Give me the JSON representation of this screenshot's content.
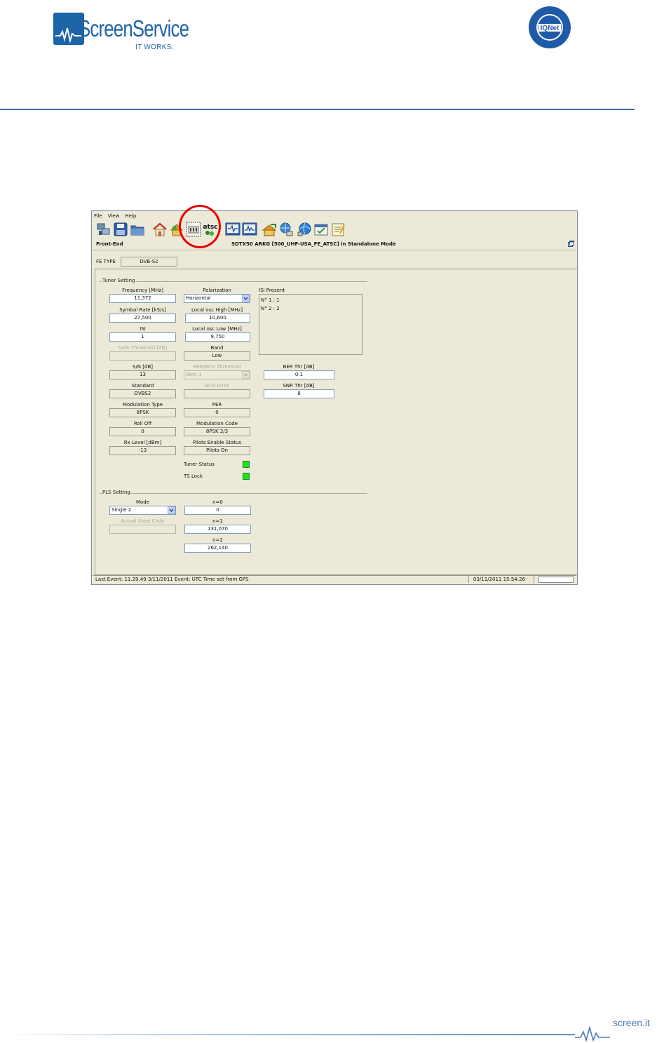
{
  "header": {
    "logo_name": "ScreenService",
    "logo_tagline": "IT WORKS.",
    "seal_text": "IQNet"
  },
  "window": {
    "menu": [
      "File",
      "View",
      "Help"
    ],
    "toolbar_icons": [
      "network-icon",
      "save-icon",
      "folder-icon",
      "home-icon",
      "up-arrow-icon",
      "front-end-icon",
      "atsc-icon",
      "monitor-icon",
      "waveform-icon",
      "export-icon",
      "globe-network-icon",
      "globe-icon",
      "checklist-icon",
      "notes-icon"
    ],
    "atsc_label": "atsc",
    "section_label": "Front-End",
    "title": "SDTX50 ARKG [500_UHF-USA_FE_ATSC] in Standalone Mode",
    "fe_type_label": "FE TYPE",
    "fe_type_value": "DVB-S2",
    "tuner": {
      "group_title": "Tuner Setting",
      "frequency_label": "Frequency [MHz]",
      "frequency_value": "11,372",
      "polarization_label": "Polarization",
      "polarization_value": "Horizontal",
      "isi_present_label": "ISI Present",
      "isi_present_items": [
        "N° 1 : 1",
        "N° 2 : 2"
      ],
      "symbol_rate_label": "Symbol Rate [kS/s]",
      "symbol_rate_value": "27,500",
      "lo_high_label": "Local osc High [MHz]",
      "lo_high_value": "10,600",
      "isi_label": "ISI",
      "isi_value": "1",
      "lo_low_label": "Local osc Low [MHz]",
      "lo_low_value": "9,750",
      "safe_threshold_label": "Safe Threshold [dB]",
      "safe_threshold_value": "",
      "band_label": "Band",
      "band_value": "Low",
      "sn_label": "S/N [dB]",
      "sn_value": "13",
      "ber_bch_threshold_label": "BER/BCH Threshold",
      "ber_bch_threshold_value": "Item 1",
      "ber_thr_label": "BER Thr [dB]",
      "ber_thr_value": "0.1",
      "standard_label": "Standard",
      "standard_value": "DVBS2",
      "bch_error_label": "BCH Error",
      "bch_error_value": "",
      "snr_thr_label": "SNR Thr [dB]",
      "snr_thr_value": "8",
      "modulation_type_label": "Modulation Type",
      "modulation_type_value": "8PSK",
      "per_label": "PER",
      "per_value": "0",
      "roll_off_label": "Roll Off",
      "roll_off_value": "0",
      "modulation_code_label": "Modulation Code",
      "modulation_code_value": "8PSK 2/3",
      "rx_level_label": "Rx Level [dBm]",
      "rx_level_value": "-13",
      "pilots_label": "Pilots Enable Status",
      "pilots_value": "Pilots On",
      "tuner_status_label": "Tuner Status",
      "ts_lock_label": "TS Lock",
      "status_color": "#22e022"
    },
    "pls": {
      "group_title": "PLS Setting",
      "mode_label": "Mode",
      "mode_value": "Single 2",
      "n0_label": "n=0",
      "n0_value": "0",
      "actual_code_label": "Actual Used Code",
      "actual_code_value": "",
      "n1_label": "n=1",
      "n1_value": "131,070",
      "n2_label": "n=2",
      "n2_value": "262,140"
    },
    "statusbar": {
      "last_event": "Last Event: 11.29.49 3/11/2011 Event: UTC Time set from GPS",
      "datetime": "03/11/2011 15:54:26"
    }
  },
  "highlight_color": "#e60000",
  "footer": {
    "site": "screen.it"
  }
}
